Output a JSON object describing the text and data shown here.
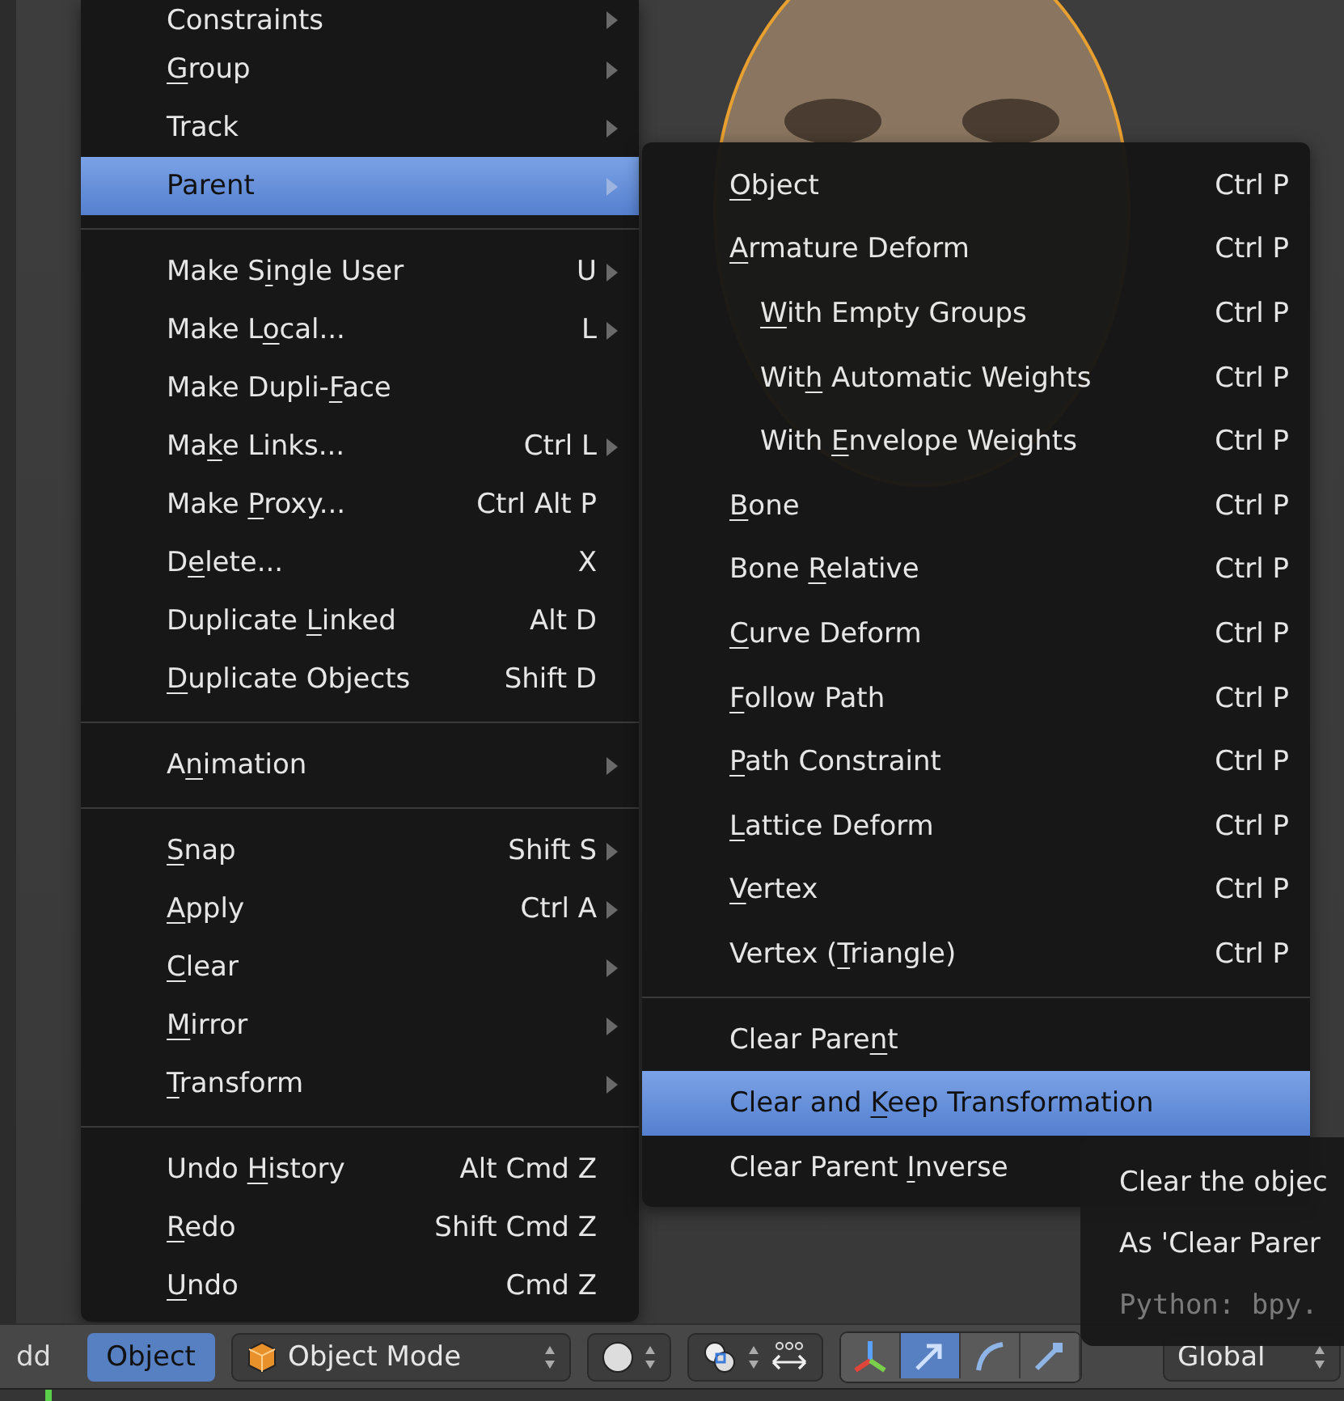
{
  "object_menu": {
    "groups": [
      [
        {
          "label": {
            "pre": "Constraints"
          },
          "submenu": true,
          "selected": false
        },
        {
          "label": {
            "key": "G",
            "post": "roup"
          },
          "submenu": true,
          "selected": false
        },
        {
          "label": {
            "pre": "Track"
          },
          "submenu": true,
          "selected": false
        },
        {
          "label": {
            "pre": "Parent"
          },
          "submenu": true,
          "selected": true
        }
      ],
      [
        {
          "label": {
            "pre": "Make S",
            "key": "i",
            "post": "ngle User"
          },
          "shortcut": "U",
          "submenu": true,
          "selected": false
        },
        {
          "label": {
            "pre": "Make L",
            "key": "o",
            "post": "cal..."
          },
          "shortcut": "L",
          "submenu": true,
          "selected": false
        },
        {
          "label": {
            "pre": "Make Dupli-",
            "key": "F",
            "post": "ace"
          },
          "submenu": false,
          "selected": false
        },
        {
          "label": {
            "pre": "Ma",
            "key": "k",
            "post": "e Links..."
          },
          "shortcut": "Ctrl L",
          "submenu": true,
          "selected": false
        },
        {
          "label": {
            "pre": "Make ",
            "key": "P",
            "post": "roxy..."
          },
          "shortcut": "Ctrl Alt P",
          "submenu": false,
          "selected": false
        },
        {
          "label": {
            "pre": "D",
            "key": "e",
            "post": "lete..."
          },
          "shortcut": "X",
          "submenu": false,
          "selected": false
        },
        {
          "label": {
            "pre": "Duplicate ",
            "key": "L",
            "post": "inked"
          },
          "shortcut": "Alt D",
          "submenu": false,
          "selected": false
        },
        {
          "label": {
            "key": "D",
            "post": "uplicate Objects"
          },
          "shortcut": "Shift D",
          "submenu": false,
          "selected": false
        }
      ],
      [
        {
          "label": {
            "pre": "A",
            "key": "n",
            "post": "imation"
          },
          "submenu": true,
          "selected": false
        }
      ],
      [
        {
          "label": {
            "key": "S",
            "post": "nap"
          },
          "shortcut": "Shift S",
          "submenu": true,
          "selected": false
        },
        {
          "label": {
            "key": "A",
            "post": "pply"
          },
          "shortcut": "Ctrl A",
          "submenu": true,
          "selected": false
        },
        {
          "label": {
            "key": "C",
            "post": "lear"
          },
          "submenu": true,
          "selected": false
        },
        {
          "label": {
            "key": "M",
            "post": "irror"
          },
          "submenu": true,
          "selected": false
        },
        {
          "label": {
            "key": "T",
            "post": "ransform"
          },
          "submenu": true,
          "selected": false
        }
      ],
      [
        {
          "label": {
            "pre": "Undo ",
            "key": "H",
            "post": "istory"
          },
          "shortcut": "Alt Cmd Z",
          "submenu": false,
          "selected": false
        },
        {
          "label": {
            "key": "R",
            "post": "edo"
          },
          "shortcut": "Shift Cmd Z",
          "submenu": false,
          "selected": false
        },
        {
          "label": {
            "key": "U",
            "post": "ndo"
          },
          "shortcut": "Cmd Z",
          "submenu": false,
          "selected": false
        }
      ]
    ]
  },
  "parent_menu": {
    "groups": [
      [
        {
          "label": {
            "key": "O",
            "post": "bject"
          },
          "shortcut": "Ctrl P",
          "selected": false
        },
        {
          "label": {
            "key": "A",
            "post": "rmature Deform"
          },
          "shortcut": "Ctrl P",
          "selected": false,
          "children": [
            {
              "label": {
                "key": "W",
                "post": "ith Empty Groups"
              },
              "shortcut": "Ctrl P",
              "selected": false
            },
            {
              "label": {
                "pre": "Wit",
                "key": "h",
                "post": " Automatic Weights"
              },
              "shortcut": "Ctrl P",
              "selected": false
            },
            {
              "label": {
                "pre": "With ",
                "key": "E",
                "post": "nvelope Weights"
              },
              "shortcut": "Ctrl P",
              "selected": false
            }
          ]
        },
        {
          "label": {
            "key": "B",
            "post": "one"
          },
          "shortcut": "Ctrl P",
          "selected": false
        },
        {
          "label": {
            "pre": "Bone ",
            "key": "R",
            "post": "elative"
          },
          "shortcut": "Ctrl P",
          "selected": false
        },
        {
          "label": {
            "key": "C",
            "post": "urve Deform"
          },
          "shortcut": "Ctrl P",
          "selected": false
        },
        {
          "label": {
            "key": "F",
            "post": "ollow Path"
          },
          "shortcut": "Ctrl P",
          "selected": false
        },
        {
          "label": {
            "key": "P",
            "post": "ath Constraint"
          },
          "shortcut": "Ctrl P",
          "selected": false
        },
        {
          "label": {
            "key": "L",
            "post": "attice Deform"
          },
          "shortcut": "Ctrl P",
          "selected": false
        },
        {
          "label": {
            "key": "V",
            "post": "ertex"
          },
          "shortcut": "Ctrl P",
          "selected": false
        },
        {
          "label": {
            "pre": "Vertex (",
            "key": "T",
            "post": "riangle)"
          },
          "shortcut": "Ctrl P",
          "selected": false
        }
      ],
      [
        {
          "label": {
            "pre": "Clear Pare",
            "key": "n",
            "post": "t"
          },
          "selected": false
        },
        {
          "label": {
            "pre": "Clear and ",
            "key": "K",
            "post": "eep Transformation"
          },
          "selected": true
        },
        {
          "label": {
            "pre": "Clear Parent ",
            "key": "I",
            "post": "nverse"
          },
          "selected": false
        }
      ]
    ]
  },
  "tooltip": {
    "lines": [
      {
        "kind": "text",
        "text": "Clear the objec"
      },
      {
        "kind": "text",
        "text": "As 'Clear Parer"
      },
      {
        "kind": "python",
        "text": "Python: bpy."
      }
    ]
  },
  "header": {
    "menus": [
      {
        "label": "dd",
        "selected": false
      },
      {
        "label": "Object",
        "selected": true
      }
    ],
    "mode_dropdown": "Object Mode",
    "manipulators": [
      {
        "selected": false
      },
      {
        "selected": true
      },
      {
        "selected": false
      },
      {
        "selected": false
      }
    ],
    "orientation": "Global"
  }
}
